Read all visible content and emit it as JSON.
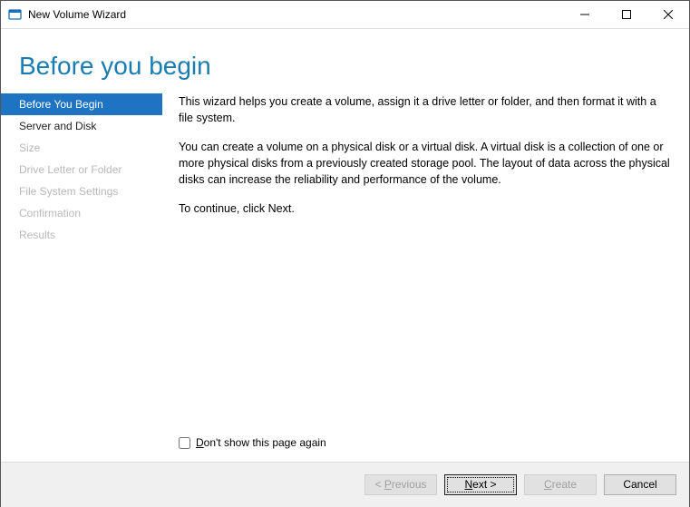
{
  "window": {
    "title": "New Volume Wizard"
  },
  "header": {
    "page_title": "Before you begin"
  },
  "sidebar": {
    "items": [
      {
        "label": "Before You Begin",
        "state": "active"
      },
      {
        "label": "Server and Disk",
        "state": "enabled"
      },
      {
        "label": "Size",
        "state": "disabled"
      },
      {
        "label": "Drive Letter or Folder",
        "state": "disabled"
      },
      {
        "label": "File System Settings",
        "state": "disabled"
      },
      {
        "label": "Confirmation",
        "state": "disabled"
      },
      {
        "label": "Results",
        "state": "disabled"
      }
    ]
  },
  "content": {
    "para1": "This wizard helps you create a volume, assign it a drive letter or folder, and then format it with a file system.",
    "para2": "You can create a volume on a physical disk or a virtual disk. A virtual disk is a collection of one or more physical disks from a previously created storage pool. The layout of data across the physical disks can increase the reliability and performance of the volume.",
    "para3": "To continue, click Next.",
    "skip_checkbox": {
      "checked": false,
      "prefix": "D",
      "rest": "on't show this page again"
    }
  },
  "footer": {
    "previous": {
      "prefix": "< ",
      "accel": "P",
      "rest": "revious",
      "enabled": false
    },
    "next": {
      "accel": "N",
      "rest": "ext >",
      "enabled": true,
      "default": true
    },
    "create": {
      "accel": "C",
      "rest": "reate",
      "enabled": false
    },
    "cancel": {
      "label": "Cancel",
      "enabled": true
    }
  }
}
